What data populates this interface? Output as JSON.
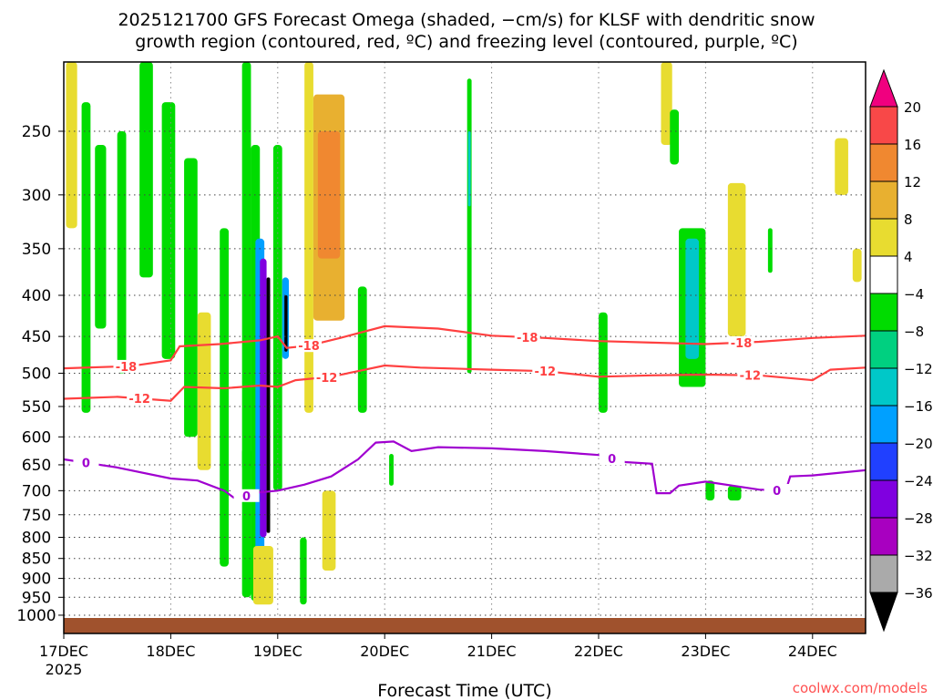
{
  "chart_data": {
    "type": "heatmap",
    "title_line1": "2025121700 GFS Forecast Omega (shaded, −cm/s) for KLSF with dendritic snow",
    "title_line2": "growth region (contoured, red, ºC) and freezing level (contoured, purple, ºC)",
    "xlabel": "Forecast Time (UTC)",
    "ylabel": "",
    "credit": "coolwx.com/models",
    "x_unit": "hours since 17DEC 00Z",
    "xlim": [
      0,
      180
    ],
    "ylim_hpa": [
      205,
      1040
    ],
    "y_scale": "log",
    "x_ticks": [
      {
        "h": 0,
        "label": "17DEC",
        "sub": "2025"
      },
      {
        "h": 24,
        "label": "18DEC",
        "sub": ""
      },
      {
        "h": 48,
        "label": "19DEC",
        "sub": ""
      },
      {
        "h": 72,
        "label": "20DEC",
        "sub": ""
      },
      {
        "h": 96,
        "label": "21DEC",
        "sub": ""
      },
      {
        "h": 120,
        "label": "22DEC",
        "sub": ""
      },
      {
        "h": 144,
        "label": "23DEC",
        "sub": ""
      },
      {
        "h": 168,
        "label": "24DEC",
        "sub": ""
      }
    ],
    "y_ticks": [
      "250",
      "300",
      "350",
      "400",
      "450",
      "500",
      "550",
      "600",
      "650",
      "700",
      "750",
      "800",
      "850",
      "900",
      "950",
      "1000"
    ],
    "grid": true,
    "colorbar": {
      "labels": [
        "20",
        "16",
        "12",
        "8",
        "4",
        "−4",
        "−8",
        "−12",
        "−16",
        "−20",
        "−24",
        "−28",
        "−32",
        "−36"
      ],
      "colors": [
        "#f84848",
        "#f08830",
        "#e8b030",
        "#e8dc30",
        "#ffffff",
        "#00dc00",
        "#00d080",
        "#00c8c8",
        "#00a0ff",
        "#2040ff",
        "#8000e0",
        "#a800c0",
        "#aaaaaa"
      ],
      "over_color": "#f0007f",
      "under_color": "#000000"
    },
    "omega_patches": [
      {
        "t": [
          0.5,
          3
        ],
        "p": [
          205,
          330
        ],
        "v": 6
      },
      {
        "t": [
          4,
          6
        ],
        "p": [
          230,
          560
        ],
        "v": -6
      },
      {
        "t": [
          7,
          9.5
        ],
        "p": [
          260,
          440
        ],
        "v": -6
      },
      {
        "t": [
          12,
          14
        ],
        "p": [
          250,
          500
        ],
        "v": -6
      },
      {
        "t": [
          17,
          20
        ],
        "p": [
          205,
          380
        ],
        "v": -6
      },
      {
        "t": [
          22,
          25
        ],
        "p": [
          230,
          480
        ],
        "v": -6
      },
      {
        "t": [
          27,
          30
        ],
        "p": [
          270,
          600
        ],
        "v": -6
      },
      {
        "t": [
          30,
          33
        ],
        "p": [
          420,
          660
        ],
        "v": 6
      },
      {
        "t": [
          35,
          37
        ],
        "p": [
          330,
          870
        ],
        "v": -6
      },
      {
        "t": [
          40,
          42
        ],
        "p": [
          205,
          660
        ],
        "v": -6
      },
      {
        "t": [
          40,
          42
        ],
        "p": [
          620,
          950
        ],
        "v": -6
      },
      {
        "t": [
          42,
          44
        ],
        "p": [
          260,
          960
        ],
        "v": -6
      },
      {
        "t": [
          43,
          45
        ],
        "p": [
          340,
          880
        ],
        "v": -18
      },
      {
        "t": [
          44,
          45.5
        ],
        "p": [
          360,
          800
        ],
        "v": -26
      },
      {
        "t": [
          45.5,
          46.3
        ],
        "p": [
          380,
          790
        ],
        "v": -40
      },
      {
        "t": [
          42.5,
          47
        ],
        "p": [
          820,
          970
        ],
        "v": 6
      },
      {
        "t": [
          47,
          49
        ],
        "p": [
          260,
          700
        ],
        "v": -6
      },
      {
        "t": [
          49,
          50.5
        ],
        "p": [
          380,
          480
        ],
        "v": -18
      },
      {
        "t": [
          49.5,
          50.2
        ],
        "p": [
          400,
          470
        ],
        "v": -40
      },
      {
        "t": [
          53,
          54.5
        ],
        "p": [
          800,
          970
        ],
        "v": -6
      },
      {
        "t": [
          54,
          56
        ],
        "p": [
          205,
          560
        ],
        "v": 6
      },
      {
        "t": [
          56,
          63
        ],
        "p": [
          225,
          430
        ],
        "v": 10
      },
      {
        "t": [
          57,
          62
        ],
        "p": [
          250,
          360
        ],
        "v": 14
      },
      {
        "t": [
          58,
          61
        ],
        "p": [
          700,
          880
        ],
        "v": 6
      },
      {
        "t": [
          66,
          68
        ],
        "p": [
          390,
          560
        ],
        "v": -6
      },
      {
        "t": [
          73,
          74
        ],
        "p": [
          630,
          690
        ],
        "v": -6
      },
      {
        "t": [
          90.5,
          91.5
        ],
        "p": [
          215,
          500
        ],
        "v": -6
      },
      {
        "t": [
          90.7,
          91.3
        ],
        "p": [
          250,
          310
        ],
        "v": -14
      },
      {
        "t": [
          120,
          122
        ],
        "p": [
          420,
          560
        ],
        "v": -6
      },
      {
        "t": [
          134,
          136.5
        ],
        "p": [
          205,
          260
        ],
        "v": 6
      },
      {
        "t": [
          136,
          138
        ],
        "p": [
          235,
          275
        ],
        "v": -6
      },
      {
        "t": [
          138,
          144
        ],
        "p": [
          330,
          520
        ],
        "v": -6
      },
      {
        "t": [
          139.5,
          142.5
        ],
        "p": [
          340,
          480
        ],
        "v": -14
      },
      {
        "t": [
          144,
          146
        ],
        "p": [
          680,
          720
        ],
        "v": -6
      },
      {
        "t": [
          149,
          153
        ],
        "p": [
          290,
          450
        ],
        "v": 6
      },
      {
        "t": [
          149,
          152
        ],
        "p": [
          690,
          720
        ],
        "v": -6
      },
      {
        "t": [
          158,
          159
        ],
        "p": [
          330,
          375
        ],
        "v": -6
      },
      {
        "t": [
          173,
          176
        ],
        "p": [
          255,
          300
        ],
        "v": 6
      },
      {
        "t": [
          177,
          179
        ],
        "p": [
          350,
          385
        ],
        "v": 6
      }
    ],
    "contours": [
      {
        "name": "-18 ºC",
        "color": "#ff4040",
        "label": "-18",
        "label_h": [
          14,
          55,
          104,
          152
        ],
        "points": [
          [
            0,
            493
          ],
          [
            15,
            490
          ],
          [
            24,
            482
          ],
          [
            26,
            463
          ],
          [
            35,
            460
          ],
          [
            44,
            455
          ],
          [
            48,
            450
          ],
          [
            50,
            465
          ],
          [
            55,
            462
          ],
          [
            62,
            452
          ],
          [
            72,
            437
          ],
          [
            84,
            440
          ],
          [
            96,
            449
          ],
          [
            108,
            452
          ],
          [
            120,
            456
          ],
          [
            132,
            458
          ],
          [
            144,
            460
          ],
          [
            156,
            457
          ],
          [
            168,
            452
          ],
          [
            180,
            449
          ]
        ]
      },
      {
        "name": "-12 ºC",
        "color": "#ff4040",
        "label": "-12",
        "label_h": [
          17,
          59,
          108,
          154
        ],
        "points": [
          [
            0,
            538
          ],
          [
            12,
            535
          ],
          [
            24,
            541
          ],
          [
            27,
            520
          ],
          [
            36,
            522
          ],
          [
            44,
            518
          ],
          [
            48,
            520
          ],
          [
            52,
            510
          ],
          [
            60,
            505
          ],
          [
            66,
            497
          ],
          [
            72,
            489
          ],
          [
            80,
            492
          ],
          [
            96,
            495
          ],
          [
            108,
            497
          ],
          [
            120,
            505
          ],
          [
            132,
            503
          ],
          [
            144,
            502
          ],
          [
            156,
            503
          ],
          [
            168,
            510
          ],
          [
            172,
            495
          ],
          [
            180,
            492
          ]
        ]
      },
      {
        "name": "0 ºC",
        "color": "#a000d0",
        "label": "0",
        "label_h": [
          5,
          41,
          123,
          160
        ],
        "points": [
          [
            0,
            640
          ],
          [
            12,
            655
          ],
          [
            24,
            676
          ],
          [
            30,
            680
          ],
          [
            36,
            700
          ],
          [
            39,
            720
          ],
          [
            42,
            705
          ],
          [
            48,
            700
          ],
          [
            54,
            688
          ],
          [
            60,
            672
          ],
          [
            66,
            640
          ],
          [
            70,
            610
          ],
          [
            74,
            608
          ],
          [
            78,
            625
          ],
          [
            84,
            618
          ],
          [
            96,
            620
          ],
          [
            108,
            625
          ],
          [
            120,
            632
          ],
          [
            126,
            645
          ],
          [
            132,
            648
          ],
          [
            133,
            705
          ],
          [
            136,
            705
          ],
          [
            138,
            690
          ],
          [
            144,
            682
          ],
          [
            156,
            698
          ],
          [
            162,
            700
          ],
          [
            163,
            672
          ],
          [
            168,
            670
          ],
          [
            180,
            660
          ]
        ]
      }
    ],
    "surface_hpa": 1008
  }
}
